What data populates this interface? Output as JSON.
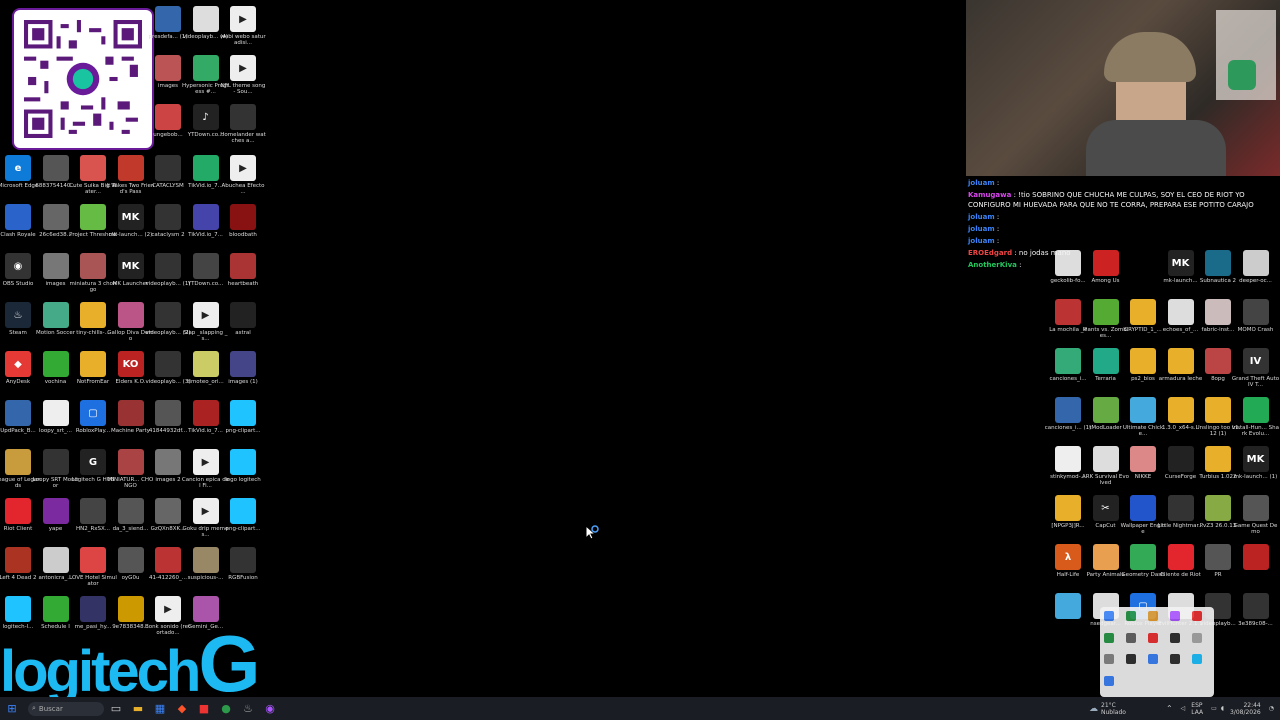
{
  "search": {
    "placeholder": "Buscar"
  },
  "brand": {
    "logo_text": "logitech",
    "trademark": "TM"
  },
  "tray": {
    "weather_temp": "21°C",
    "weather_desc": "Nublado",
    "lang": "ESP",
    "layout": "LAA",
    "time": "22:44",
    "date": "3/08/2026"
  },
  "chat": [
    {
      "user": "joluam",
      "text": ":",
      "color": "#3b82f6"
    },
    {
      "user": "Kamugawa",
      "text": ": !tio SOBRINO QUE CHUCHA ME CULPAS, SOY EL CEO DE RIOT YO CONFIGURO MI HUEVADA PARA QUE NO TE CORRA, PREPARA ESE POTITO CARAJO",
      "color": "#d946ef"
    },
    {
      "user": "joluam",
      "text": ":",
      "color": "#3b82f6"
    },
    {
      "user": "joluam",
      "text": ":",
      "color": "#3b82f6"
    },
    {
      "user": "joluam",
      "text": ":",
      "color": "#3b82f6"
    },
    {
      "user": "EROEdgard",
      "text": ": no jodas mano",
      "color": "#ef4444"
    },
    {
      "user": "AnotherKiva",
      "text": ":",
      "color": "#22c55e"
    }
  ],
  "left_icons": [
    {
      "label": "Microsoft Edge",
      "color": "#0f7bd8",
      "glyph": "e"
    },
    {
      "label": "6883754140...",
      "color": "#555",
      "glyph": ""
    },
    {
      "label": "Cute Suika Big Water...",
      "color": "#d9534f",
      "glyph": ""
    },
    {
      "label": "It Takes Two Friend's Pass",
      "color": "#c0392b",
      "glyph": ""
    },
    {
      "label": "CATACLYSM",
      "color": "#333",
      "glyph": ""
    },
    {
      "label": "TikVid.io_7...",
      "color": "#2a6",
      "glyph": ""
    },
    {
      "label": "Abuchea Efecto ...",
      "color": "#eee",
      "glyph": "▶"
    },
    {
      "label": "Clash Royale",
      "color": "#2a63c9",
      "glyph": ""
    },
    {
      "label": "26c6ed38...",
      "color": "#666",
      "glyph": ""
    },
    {
      "label": "Project Threshold",
      "color": "#6b4",
      "glyph": ""
    },
    {
      "label": "mk-launch... (2)",
      "color": "#222",
      "glyph": "MK"
    },
    {
      "label": "cataclysm 2",
      "color": "#333",
      "glyph": ""
    },
    {
      "label": "TikVid.io_7...",
      "color": "#44a",
      "glyph": ""
    },
    {
      "label": "bloodbath",
      "color": "#811",
      "glyph": ""
    },
    {
      "label": "OBS Studio",
      "color": "#333",
      "glyph": "◉"
    },
    {
      "label": "images",
      "color": "#777",
      "glyph": ""
    },
    {
      "label": "miniatura 3 chongo",
      "color": "#a55",
      "glyph": ""
    },
    {
      "label": "MK Launcher",
      "color": "#222",
      "glyph": "MK"
    },
    {
      "label": "videoplayb... (1)",
      "color": "#333",
      "glyph": ""
    },
    {
      "label": "YTDown.co...",
      "color": "#444",
      "glyph": ""
    },
    {
      "label": "heartbeath",
      "color": "#a33",
      "glyph": ""
    },
    {
      "label": "Steam",
      "color": "#1b2838",
      "glyph": "♨"
    },
    {
      "label": "Motion Soccer",
      "color": "#4a8",
      "glyph": ""
    },
    {
      "label": "tiny-chills-...",
      "color": "#e8b02a",
      "glyph": ""
    },
    {
      "label": "Gallop Diva Demo",
      "color": "#b58",
      "glyph": ""
    },
    {
      "label": "videoplayb... (2)",
      "color": "#333",
      "glyph": ""
    },
    {
      "label": "Slap _slapping _s...",
      "color": "#eee",
      "glyph": "▶"
    },
    {
      "label": "astral",
      "color": "#222",
      "glyph": ""
    },
    {
      "label": "AnyDesk",
      "color": "#e53935",
      "glyph": "◆"
    },
    {
      "label": "vochina",
      "color": "#3a3",
      "glyph": ""
    },
    {
      "label": "NotFromEar",
      "color": "#e8b02a",
      "glyph": ""
    },
    {
      "label": "Elders K.O.",
      "color": "#b22",
      "glyph": "KO"
    },
    {
      "label": "videoplayb... (3)",
      "color": "#333",
      "glyph": ""
    },
    {
      "label": "timoteo_ori...",
      "color": "#cc6",
      "glyph": ""
    },
    {
      "label": "images (1)",
      "color": "#448",
      "glyph": ""
    },
    {
      "label": "UpdPack_B...",
      "color": "#36a",
      "glyph": ""
    },
    {
      "label": "loopy_srt_...",
      "color": "#eee",
      "glyph": ""
    },
    {
      "label": "RobloxPlay...",
      "color": "#1e6fe0",
      "glyph": "▢"
    },
    {
      "label": "Machine Party",
      "color": "#933",
      "glyph": ""
    },
    {
      "label": "41844932df...",
      "color": "#555",
      "glyph": ""
    },
    {
      "label": "TikVid.io_7...",
      "color": "#a22",
      "glyph": ""
    },
    {
      "label": "png-clipart...",
      "color": "#1ec3ff",
      "glyph": ""
    },
    {
      "label": "League of Legends",
      "color": "#c89b3c",
      "glyph": ""
    },
    {
      "label": "Loopy SRT Monitor",
      "color": "#333",
      "glyph": ""
    },
    {
      "label": "Logitech G HUB",
      "color": "#222",
      "glyph": "G"
    },
    {
      "label": "MINIATUR... CHONGO",
      "color": "#a44",
      "glyph": ""
    },
    {
      "label": "images 2",
      "color": "#777",
      "glyph": ""
    },
    {
      "label": "Cancion epica del Fi...",
      "color": "#eee",
      "glyph": "▶"
    },
    {
      "label": "logo logitech",
      "color": "#1ec3ff",
      "glyph": ""
    },
    {
      "label": "Riot Client",
      "color": "#e3262e",
      "glyph": ""
    },
    {
      "label": "yape",
      "color": "#7b2aa0",
      "glyph": ""
    },
    {
      "label": "HN2_RxSX...",
      "color": "#444",
      "glyph": ""
    },
    {
      "label": "da_3_siend...",
      "color": "#555",
      "glyph": ""
    },
    {
      "label": "GzQXn8XK...",
      "color": "#666",
      "glyph": ""
    },
    {
      "label": "Goku drip meme s...",
      "color": "#eee",
      "glyph": "▶"
    },
    {
      "label": "png-clipart...",
      "color": "#1ec3ff",
      "glyph": ""
    },
    {
      "label": "Left 4 Dead 2",
      "color": "#a32",
      "glyph": ""
    },
    {
      "label": "antonicra_...",
      "color": "#ccc",
      "glyph": ""
    },
    {
      "label": "LOVE Hotel Simulator",
      "color": "#d44",
      "glyph": ""
    },
    {
      "label": "oyG0u",
      "color": "#555",
      "glyph": ""
    },
    {
      "label": "41-412260_...",
      "color": "#b33",
      "glyph": ""
    },
    {
      "label": "suspicious-...",
      "color": "#986",
      "glyph": ""
    },
    {
      "label": "RGBFusion",
      "color": "#333",
      "glyph": ""
    },
    {
      "label": "logitech-l...",
      "color": "#1ec3ff",
      "glyph": ""
    },
    {
      "label": "Schedule I",
      "color": "#3a3",
      "glyph": ""
    },
    {
      "label": "me_pasi_hy...",
      "color": "#336",
      "glyph": ""
    },
    {
      "label": "9e7838348...",
      "color": "#c90",
      "glyph": ""
    },
    {
      "label": "Bonk sonido (recortado...",
      "color": "#eee",
      "glyph": "▶"
    },
    {
      "label": "Gemini_Ge...",
      "color": "#a5a",
      "glyph": ""
    }
  ],
  "top_icons": [
    {
      "label": "presdefa... (1)",
      "color": "#36a",
      "glyph": ""
    },
    {
      "label": "videoplayb... (4)",
      "color": "#ddd",
      "glyph": ""
    },
    {
      "label": "webi webo saturadisi...",
      "color": "#eee",
      "glyph": "▶"
    },
    {
      "label": "images",
      "color": "#b55",
      "glyph": ""
    },
    {
      "label": "Hypersonic Progress #...",
      "color": "#3a6",
      "glyph": ""
    },
    {
      "label": "NFL theme song - Sou...",
      "color": "#eee",
      "glyph": "▶"
    },
    {
      "label": "ungebob...",
      "color": "#c44",
      "glyph": ""
    },
    {
      "label": "YTDown.co...",
      "color": "#222",
      "glyph": "♪"
    },
    {
      "label": "Homelander watches a...",
      "color": "#333",
      "glyph": ""
    }
  ],
  "right_icons": [
    {
      "label": "geckolib-fo...",
      "color": "#ddd",
      "glyph": ""
    },
    {
      "label": "Among Us",
      "color": "#c22",
      "glyph": ""
    },
    {
      "label": "mk-launch...",
      "color": "#222",
      "glyph": "MK"
    },
    {
      "label": "Subnautica 2",
      "color": "#1a6a8a",
      "glyph": ""
    },
    {
      "label": "deeper-oc...",
      "color": "#ccc",
      "glyph": ""
    },
    {
      "label": "La mochila _v",
      "color": "#b33",
      "glyph": ""
    },
    {
      "label": "Plants vs. Zombies...",
      "color": "#5a3",
      "glyph": ""
    },
    {
      "label": "CRYPTID_1_...",
      "color": "#e8b02a",
      "glyph": ""
    },
    {
      "label": "echoes_of_...",
      "color": "#ddd",
      "glyph": ""
    },
    {
      "label": "fabric-inst...",
      "color": "#cbb",
      "glyph": ""
    },
    {
      "label": "MOMO Crash",
      "color": "#444",
      "glyph": ""
    },
    {
      "label": "canciones_i...",
      "color": "#3a7",
      "glyph": ""
    },
    {
      "label": "Terraria",
      "color": "#2a8",
      "glyph": ""
    },
    {
      "label": "ps2_bios",
      "color": "#e8b02a",
      "glyph": ""
    },
    {
      "label": "armadura leche",
      "color": "#e8b02a",
      "glyph": ""
    },
    {
      "label": "8opg",
      "color": "#b44",
      "glyph": ""
    },
    {
      "label": "Grand Theft Auto IV T...",
      "color": "#333",
      "glyph": "IV"
    },
    {
      "label": "canciones_i... (1)",
      "color": "#36a",
      "glyph": ""
    },
    {
      "label": "tModLoader",
      "color": "#6a4",
      "glyph": ""
    },
    {
      "label": "Ultimate Chicke...",
      "color": "#4ad",
      "glyph": ""
    },
    {
      "label": "1.3.0_x64-s...",
      "color": "#e8b02a",
      "glyph": ""
    },
    {
      "label": "Unslingo too v1.12 (1)",
      "color": "#e8b02a",
      "glyph": ""
    },
    {
      "label": "Install-Hun... Shark Evolu...",
      "color": "#2a5",
      "glyph": ""
    },
    {
      "label": "stinkymod-...",
      "color": "#eee",
      "glyph": ""
    },
    {
      "label": "ARK Survival Evolved",
      "color": "#ddd",
      "glyph": ""
    },
    {
      "label": "NIKKE",
      "color": "#d88",
      "glyph": ""
    },
    {
      "label": "CurseForge",
      "color": "#222",
      "glyph": ""
    },
    {
      "label": "Turbius 1.022",
      "color": "#e8b02a",
      "glyph": ""
    },
    {
      "label": "mk-launch... (1)",
      "color": "#222",
      "glyph": "MK"
    },
    {
      "label": "[NPGP3J]R...",
      "color": "#e8b02a",
      "glyph": ""
    },
    {
      "label": "CapCut",
      "color": "#222",
      "glyph": "✂"
    },
    {
      "label": "Wallpaper Engine",
      "color": "#2255cc",
      "glyph": ""
    },
    {
      "label": "Little Nightmar...",
      "color": "#333",
      "glyph": ""
    },
    {
      "label": "PvZ3 26.0.13",
      "color": "#8a4",
      "glyph": ""
    },
    {
      "label": "Game Quest Demo",
      "color": "#555",
      "glyph": ""
    },
    {
      "label": "Half-Life",
      "color": "#d95b1c",
      "glyph": "λ"
    },
    {
      "label": "Party Animals",
      "color": "#e8a050",
      "glyph": ""
    },
    {
      "label": "Geometry Dash",
      "color": "#3a5",
      "glyph": ""
    },
    {
      "label": "Cliente de Riot",
      "color": "#e3262e",
      "glyph": ""
    },
    {
      "label": "PR",
      "color": "#555",
      "glyph": ""
    },
    {
      "label": "",
      "color": "#b22",
      "glyph": ""
    },
    {
      "label": "",
      "color": "#4ad",
      "glyph": ""
    },
    {
      "label": "nsedgear...",
      "color": "#ddd",
      "glyph": ""
    },
    {
      "label": "Roblox Player",
      "color": "#1e6fe0",
      "glyph": "▢"
    },
    {
      "label": "EvilHunter 2.1.1",
      "color": "#ddd",
      "glyph": ""
    },
    {
      "label": "videoplayb...",
      "color": "#333",
      "glyph": ""
    },
    {
      "label": "3e389c08-...",
      "color": "#333",
      "glyph": ""
    }
  ],
  "taskbar": [
    {
      "name": "start-icon",
      "glyph": "⊞",
      "color": "#3b82f6"
    },
    {
      "name": "task-view-icon",
      "glyph": "▭",
      "color": "#ccc"
    },
    {
      "name": "file-explorer-icon",
      "glyph": "▬",
      "color": "#e8b02a"
    },
    {
      "name": "store-icon",
      "glyph": "▦",
      "color": "#3b82f6"
    },
    {
      "name": "brave-icon",
      "glyph": "◆",
      "color": "#fb542b"
    },
    {
      "name": "capture-icon",
      "glyph": "■",
      "color": "#e33"
    },
    {
      "name": "chrome-icon",
      "glyph": "●",
      "color": "#2c9a4a"
    },
    {
      "name": "steam-icon",
      "glyph": "♨",
      "color": "#aaa"
    },
    {
      "name": "gamebar-icon",
      "glyph": "◉",
      "color": "#a5f"
    }
  ]
}
